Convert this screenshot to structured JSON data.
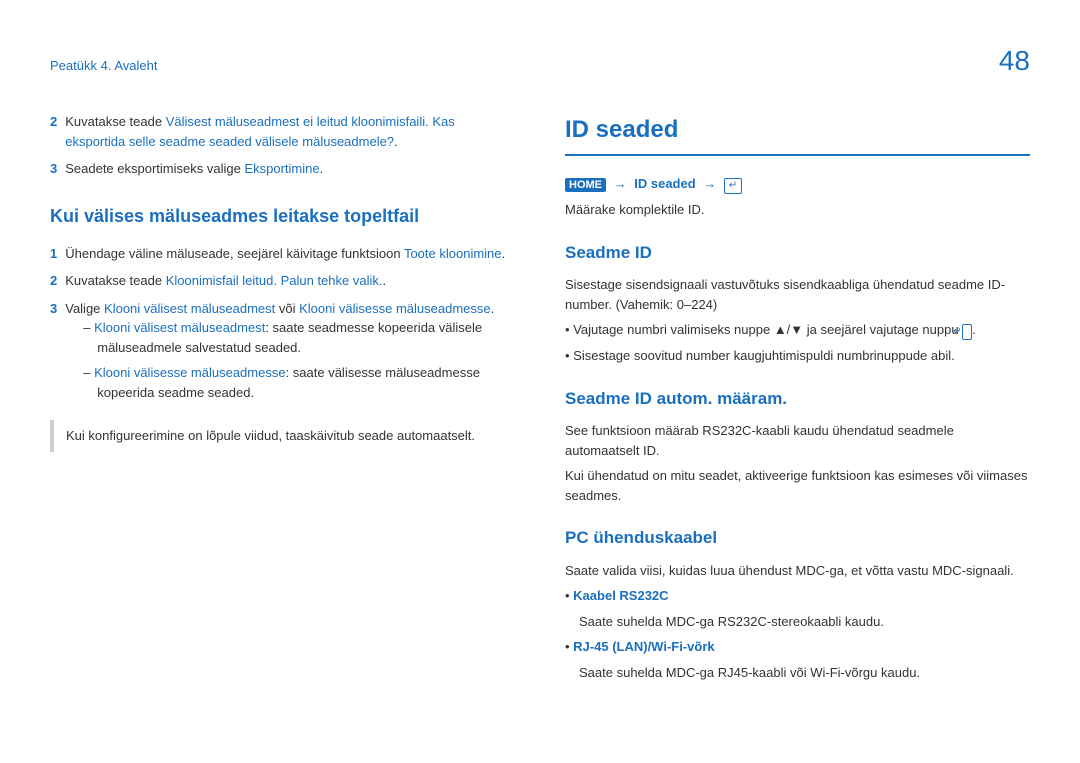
{
  "header": {
    "breadcrumb": "Peatükk 4. Avaleht",
    "page_number": "48"
  },
  "left": {
    "items": {
      "n2": "2",
      "t2a": "Kuvatakse teade ",
      "t2b": "Välisest mäluseadmest ei leitud kloonimisfaili. Kas eksportida selle seadme seaded välisele mäluseadmele?",
      "t2c": ".",
      "n3": "3",
      "t3a": "Seadete eksportimiseks valige ",
      "t3b": "Eksportimine",
      "t3c": "."
    },
    "h2": "Kui välises mäluseadmes leitakse topeltfail",
    "sub": {
      "n1": "1",
      "t1a": "Ühendage väline mäluseade, seejärel käivitage funktsioon ",
      "t1b": "Toote kloonimine",
      "t1c": ".",
      "n2": "2",
      "t2a": "Kuvatakse teade ",
      "t2b": "Kloonimisfail leitud. Palun tehke valik.",
      "t2c": ".",
      "n3": "3",
      "t3a": "Valige ",
      "t3b": "Klooni välisest mäluseadmest",
      "t3c": " või ",
      "t3d": "Klooni välisesse mäluseadmesse",
      "t3e": ".",
      "d1a": "Klooni välisest mäluseadmest",
      "d1b": ": saate seadmesse kopeerida välisele mäluseadmele salvestatud seaded.",
      "d2a": "Klooni välisesse mäluseadmesse",
      "d2b": ": saate välisesse mäluseadmesse kopeerida seadme seaded."
    },
    "note": "Kui konfigureerimine on lõpule viidud, taaskäivitub seade automaatselt."
  },
  "right": {
    "h1": "ID seaded",
    "home": "HOME",
    "path_link": "ID seaded",
    "enter_glyph": "↵",
    "p1": "Määrake komplektile ID.",
    "s1": {
      "title": "Seadme ID",
      "p": "Sisestage sisendsignaali vastuvõtuks sisendkaabliga ühendatud seadme ID-number. (Vahemik: 0–224)",
      "b1a": "Vajutage numbri valimiseks nuppe ▲/▼ ja seejärel vajutage nuppu ",
      "b1b": ".",
      "b2": "Sisestage soovitud number kaugjuhtimispuldi numbrinuppude abil."
    },
    "s2": {
      "title": "Seadme ID autom. määram.",
      "p1": "See funktsioon määrab RS232C-kaabli kaudu ühendatud seadmele automaatselt ID.",
      "p2": "Kui ühendatud on mitu seadet, aktiveerige funktsioon kas esimeses või viimases seadmes."
    },
    "s3": {
      "title": "PC ühenduskaabel",
      "p": "Saate valida viisi, kuidas luua ühendust MDC-ga, et võtta vastu MDC-signaali.",
      "b1": "Kaabel RS232C",
      "b1t": "Saate suhelda MDC-ga RS232C-stereokaabli kaudu.",
      "b2": "RJ-45 (LAN)/Wi-Fi-võrk",
      "b2t": "Saate suhelda MDC-ga RJ45-kaabli või Wi-Fi-võrgu kaudu."
    }
  }
}
